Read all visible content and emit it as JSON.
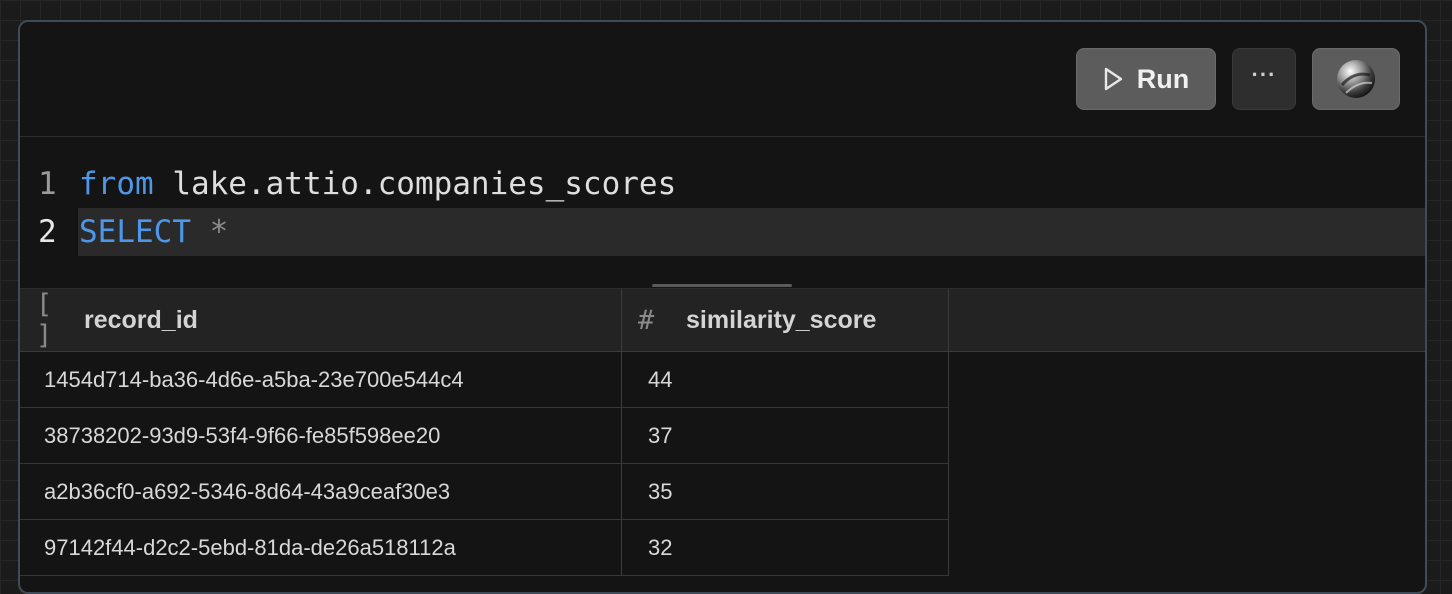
{
  "toolbar": {
    "run_label": "Run",
    "more_label": "···"
  },
  "editor": {
    "lines": [
      {
        "number": "1",
        "keyword": "from",
        "rest": " lake.attio.companies_scores"
      },
      {
        "number": "2",
        "keyword": "SELECT",
        "rest": " *"
      }
    ]
  },
  "table": {
    "columns": [
      {
        "label": "record_id",
        "icon": "[ ]"
      },
      {
        "label": "similarity_score",
        "icon": "#"
      }
    ],
    "rows": [
      [
        "1454d714-ba36-4d6e-a5ba-23e700e544c4",
        "44"
      ],
      [
        "38738202-93d9-53f4-9f66-fe85f598ee20",
        "37"
      ],
      [
        "a2b36cf0-a692-5346-8d64-43a9ceaf30e3",
        "35"
      ],
      [
        "97142f44-d2c2-5ebd-81da-de26a518112a",
        "32"
      ]
    ]
  }
}
